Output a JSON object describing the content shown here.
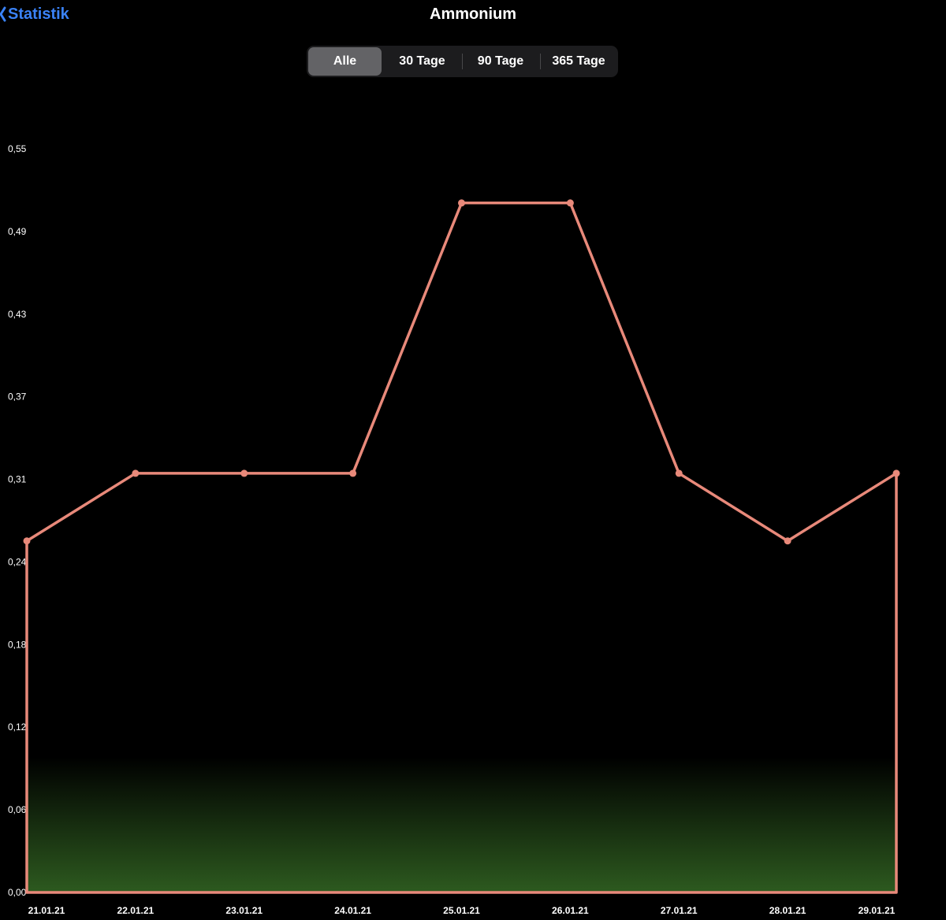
{
  "nav": {
    "back_label": "Statistik",
    "title": "Ammonium"
  },
  "filter": {
    "segments": [
      "Alle",
      "30 Tage",
      "90 Tage",
      "365 Tage"
    ],
    "selected": "Alle"
  },
  "colors": {
    "line": "#e8897a",
    "accent": "#3a82f7",
    "safe_zone": "#2d5a1f",
    "segment_selected": "#636366",
    "segment_bg": "#1c1c1e"
  },
  "icons": {
    "back": "chevron-left-icon"
  },
  "chart_data": {
    "type": "line",
    "title": "",
    "xlabel": "",
    "ylabel": "",
    "x": [
      "21.01.21",
      "22.01.21",
      "23.01.21",
      "24.01.21",
      "25.01.21",
      "26.01.21",
      "27.01.21",
      "28.01.21",
      "29.01.21"
    ],
    "series": [
      {
        "values": [
          0.26,
          0.31,
          0.31,
          0.31,
          0.51,
          0.51,
          0.31,
          0.26,
          0.31
        ]
      }
    ],
    "yticks": [
      "0,00",
      "0,06",
      "0,12",
      "0,18",
      "0,24",
      "0,31",
      "0,37",
      "0,43",
      "0,49",
      "0,55"
    ],
    "ylim": [
      0,
      0.55
    ],
    "safe_band": [
      0,
      0.1
    ],
    "grid": false,
    "legend": "none"
  }
}
